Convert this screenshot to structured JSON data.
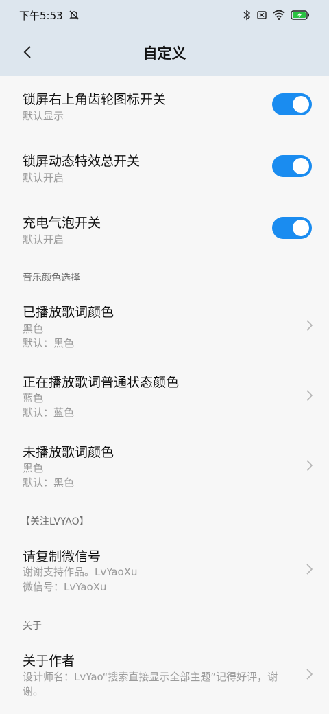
{
  "status_bar": {
    "time": "下午5:53",
    "icons": [
      "mute-bell-icon",
      "bluetooth-icon",
      "sim-off-icon",
      "wifi-icon",
      "battery-charging-icon"
    ],
    "battery_color": "#29c241"
  },
  "header": {
    "title": "自定义",
    "back_icon": "chevron-left-icon"
  },
  "toggles": [
    {
      "title": "锁屏右上角齿轮图标开关",
      "sub": "默认显示",
      "on": true
    },
    {
      "title": "锁屏动态特效总开关",
      "sub": "默认开启",
      "on": true
    },
    {
      "title": "充电气泡开关",
      "sub": "默认开启",
      "on": true
    }
  ],
  "sections": {
    "music": "音乐颜色选择",
    "follow": "【关注LVYAO】",
    "about": "关于"
  },
  "music_items": [
    {
      "title": "已播放歌词颜色",
      "value": "黑色",
      "default": "默认：黑色"
    },
    {
      "title": "正在播放歌词普通状态颜色",
      "value": "蓝色",
      "default": "默认：蓝色"
    },
    {
      "title": "未播放歌词颜色",
      "value": "黑色",
      "default": "默认：黑色"
    }
  ],
  "follow_item": {
    "title": "请复制微信号",
    "line1": "谢谢支持作品。LvYaoXu",
    "line2": "微信号：LvYaoXu"
  },
  "about_item": {
    "title": "关于作者",
    "line1": "设计师名：LvYao“搜索直接显示全部主题”记得好评，谢",
    "line2": "谢。"
  },
  "colors": {
    "accent": "#1a8cf0",
    "header_bg": "#dde6ee",
    "page_bg": "#f7f7f7"
  }
}
